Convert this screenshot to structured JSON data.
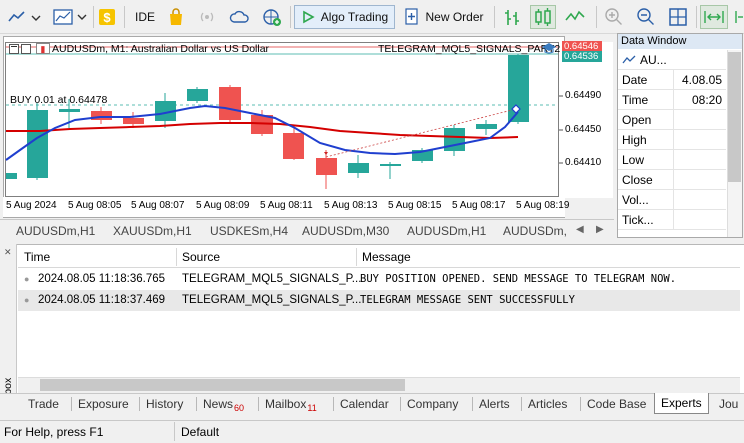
{
  "toolbar": {
    "ide_label": "IDE",
    "algo_trading_label": "Algo Trading",
    "new_order_label": "New Order"
  },
  "chart": {
    "symbol_title": "AUDUSDm, M1:  Australian Dollar vs US Dollar",
    "ea_name": "TELEGRAM_MQL5_SIGNALS_PART2",
    "trade_label": "BUY 0.01 at 0.64478",
    "bid_price": "0.64546",
    "ask_price": "0.64536",
    "price_ticks": [
      "0.64490",
      "0.64450",
      "0.64410"
    ],
    "time_ticks": [
      "5 Aug 2024",
      "5 Aug 08:05",
      "5 Aug 08:07",
      "5 Aug 08:09",
      "5 Aug 08:11",
      "5 Aug 08:13",
      "5 Aug 08:15",
      "5 Aug 08:17",
      "5 Aug 08:19"
    ],
    "colors": {
      "bull": "#26a69a",
      "bear": "#ef5350",
      "ma_fast": "#1f3fcf",
      "ma_slow": "#d40000"
    }
  },
  "data_window": {
    "title": "Data Window",
    "symbol": "AU...",
    "rows": [
      {
        "label": "Date",
        "value": "4.08.05"
      },
      {
        "label": "Time",
        "value": "08:20"
      },
      {
        "label": "Open",
        "value": ""
      },
      {
        "label": "High",
        "value": ""
      },
      {
        "label": "Low",
        "value": ""
      },
      {
        "label": "Close",
        "value": ""
      },
      {
        "label": "Vol...",
        "value": ""
      },
      {
        "label": "Tick...",
        "value": ""
      }
    ]
  },
  "chart_tabs": [
    "AUDUSDm,H1",
    "XAUUSDm,H1",
    "USDKESm,H4",
    "AUDUSDm,M30",
    "AUDUSDm,H1",
    "AUDUSDm,"
  ],
  "journal": {
    "headers": {
      "time": "Time",
      "source": "Source",
      "message": "Message"
    },
    "rows": [
      {
        "time": "2024.08.05 11:18:36.765",
        "source": "TELEGRAM_MQL5_SIGNALS_P...",
        "message": "BUY POSITION OPENED. SEND MESSAGE TO TELEGRAM NOW."
      },
      {
        "time": "2024.08.05 11:18:37.469",
        "source": "TELEGRAM_MQL5_SIGNALS_P...",
        "message": "TELEGRAM MESSAGE SENT SUCCESSFULLY"
      }
    ]
  },
  "toolbox_label": "Toolbox",
  "bottom_tabs": [
    {
      "label": "Trade",
      "badge": ""
    },
    {
      "label": "Exposure",
      "badge": ""
    },
    {
      "label": "History",
      "badge": ""
    },
    {
      "label": "News",
      "badge": "60"
    },
    {
      "label": "Mailbox",
      "badge": "11"
    },
    {
      "label": "Calendar",
      "badge": ""
    },
    {
      "label": "Company",
      "badge": ""
    },
    {
      "label": "Alerts",
      "badge": ""
    },
    {
      "label": "Articles",
      "badge": ""
    },
    {
      "label": "Code Base",
      "badge": ""
    },
    {
      "label": "Experts",
      "badge": ""
    },
    {
      "label": "Jou",
      "badge": ""
    }
  ],
  "status": {
    "help": "For Help, press F1",
    "profile": "Default"
  }
}
